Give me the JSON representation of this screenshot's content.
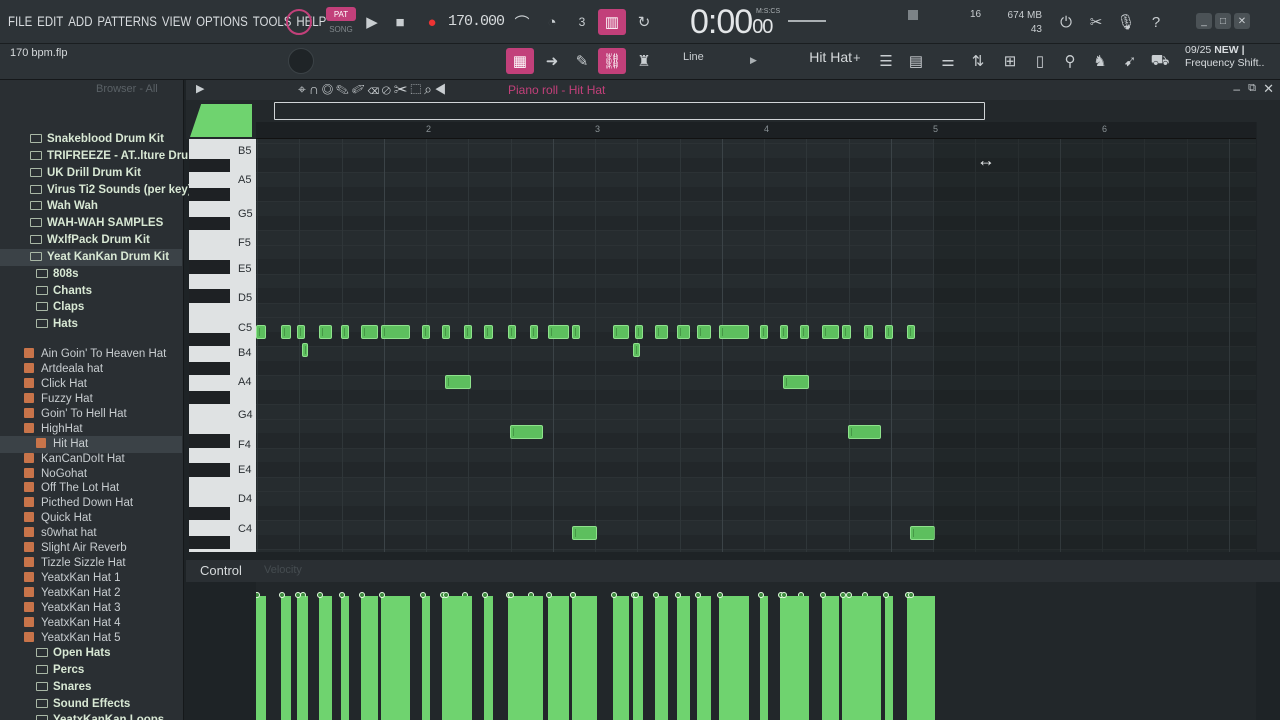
{
  "menu": [
    "FILE",
    "EDIT",
    "ADD",
    "PATTERNS",
    "VIEW",
    "OPTIONS",
    "TOOLS",
    "HELP"
  ],
  "transport": {
    "pat": "PAT",
    "song": "SONG",
    "tempo": "170.000",
    "time": "0:00",
    "time_small": "00",
    "time_label": "M:S:CS"
  },
  "status": {
    "mixer_value": "16",
    "memory": "674 MB",
    "cpu": "43"
  },
  "toolbar2": {
    "filename": "170 bpm.flp",
    "snap": "Line",
    "instrument": "Hit Hat",
    "hint_date": "09/25",
    "hint_new": "NEW |",
    "hint_text": "Frequency Shift.."
  },
  "browser": {
    "header": "Browser - All",
    "items": [
      {
        "label": "Snakeblood Drum Kit",
        "type": "folder",
        "indent": 0
      },
      {
        "label": "TRIFREEZE - AT..lture Drum Kit",
        "type": "folder",
        "indent": 0
      },
      {
        "label": "UK Drill Drum Kit",
        "type": "folder",
        "indent": 0
      },
      {
        "label": "Virus Ti2 Sounds (per key)",
        "type": "folder",
        "indent": 0
      },
      {
        "label": "Wah Wah",
        "type": "folder",
        "indent": 0
      },
      {
        "label": "WAH-WAH SAMPLES",
        "type": "folder",
        "indent": 0
      },
      {
        "label": "WxlfPack Drum Kit",
        "type": "folder",
        "indent": 0
      },
      {
        "label": "Yeat KanKan Drum Kit",
        "type": "folder",
        "indent": 0
      },
      {
        "label": "808s",
        "type": "folder",
        "indent": 1
      },
      {
        "label": "Chants",
        "type": "folder",
        "indent": 1
      },
      {
        "label": "Claps",
        "type": "folder",
        "indent": 1
      },
      {
        "label": "Hats",
        "type": "folder",
        "indent": 1
      },
      {
        "label": "",
        "type": "blank",
        "indent": 0
      },
      {
        "label": "Ain Goin' To Heaven Hat",
        "type": "file",
        "indent": 1
      },
      {
        "label": "Artdeala hat",
        "type": "file",
        "indent": 1
      },
      {
        "label": "Click Hat",
        "type": "file",
        "indent": 1
      },
      {
        "label": "Fuzzy Hat",
        "type": "file",
        "indent": 1
      },
      {
        "label": "Goin' To Hell Hat",
        "type": "file",
        "indent": 1
      },
      {
        "label": "HighHat",
        "type": "file",
        "indent": 1
      },
      {
        "label": "Hit Hat",
        "type": "file",
        "indent": 2
      },
      {
        "label": "KanCanDoIt Hat",
        "type": "file",
        "indent": 1
      },
      {
        "label": "NoGohat",
        "type": "file",
        "indent": 1
      },
      {
        "label": "Off The Lot Hat",
        "type": "file",
        "indent": 1
      },
      {
        "label": "Picthed Down Hat",
        "type": "file",
        "indent": 1
      },
      {
        "label": "Quick Hat",
        "type": "file",
        "indent": 1
      },
      {
        "label": "s0what hat",
        "type": "file",
        "indent": 1
      },
      {
        "label": "Slight Air Reverb",
        "type": "file",
        "indent": 1
      },
      {
        "label": "Tizzle Sizzle Hat",
        "type": "file",
        "indent": 1
      },
      {
        "label": "YeatxKan Hat 1",
        "type": "file",
        "indent": 1
      },
      {
        "label": "YeatxKan Hat 2",
        "type": "file",
        "indent": 1
      },
      {
        "label": "YeatxKan Hat 3",
        "type": "file",
        "indent": 1
      },
      {
        "label": "YeatxKan Hat 4",
        "type": "file",
        "indent": 1
      },
      {
        "label": "YeatxKan Hat 5",
        "type": "file",
        "indent": 1
      },
      {
        "label": "Open Hats",
        "type": "folder",
        "indent": 1
      },
      {
        "label": "Percs",
        "type": "folder",
        "indent": 1
      },
      {
        "label": "Snares",
        "type": "folder",
        "indent": 1
      },
      {
        "label": "Sound Effects",
        "type": "folder",
        "indent": 1
      },
      {
        "label": "YeatxKanKan Loops",
        "type": "folder",
        "indent": 1
      }
    ]
  },
  "piano_roll": {
    "title": "Piano roll - Hit Hat",
    "bar_numbers": [
      "2",
      "3",
      "4",
      "5",
      "6"
    ],
    "key_labels": [
      "B5",
      "A5",
      "G5",
      "F5",
      "E5",
      "D5",
      "C5",
      "B4",
      "A4",
      "G4",
      "F4",
      "E4",
      "D4",
      "C4"
    ],
    "control_label": "Control",
    "control_param": "Velocity"
  },
  "notes": [
    {
      "pitch": "C5",
      "start": 0,
      "len": 0.06
    },
    {
      "pitch": "C5",
      "start": 0.15,
      "len": 0.06
    },
    {
      "pitch": "B4",
      "start": 0.27,
      "len": 0.04
    },
    {
      "pitch": "C5",
      "start": 0.24,
      "len": 0.05
    },
    {
      "pitch": "C5",
      "start": 0.37,
      "len": 0.08
    },
    {
      "pitch": "C5",
      "start": 0.5,
      "len": 0.05
    },
    {
      "pitch": "C5",
      "start": 0.62,
      "len": 0.1
    },
    {
      "pitch": "C5",
      "start": 0.74,
      "len": 0.17
    },
    {
      "pitch": "C5",
      "start": 0.98,
      "len": 0.05
    },
    {
      "pitch": "C5",
      "start": 1.1,
      "len": 0.05
    },
    {
      "pitch": "C5",
      "start": 1.23,
      "len": 0.05
    },
    {
      "pitch": "C5",
      "start": 1.35,
      "len": 0.05
    },
    {
      "pitch": "C5",
      "start": 1.49,
      "len": 0.05
    },
    {
      "pitch": "C5",
      "start": 1.62,
      "len": 0.05
    },
    {
      "pitch": "C5",
      "start": 1.73,
      "len": 0.12
    },
    {
      "pitch": "C5",
      "start": 1.87,
      "len": 0.05
    },
    {
      "pitch": "C5",
      "start": 2.11,
      "len": 0.1
    },
    {
      "pitch": "B4",
      "start": 2.23,
      "len": 0.04
    },
    {
      "pitch": "C5",
      "start": 2.24,
      "len": 0.05
    },
    {
      "pitch": "C5",
      "start": 2.36,
      "len": 0.08
    },
    {
      "pitch": "C5",
      "start": 2.49,
      "len": 0.08
    },
    {
      "pitch": "C5",
      "start": 2.61,
      "len": 0.08
    },
    {
      "pitch": "C5",
      "start": 2.74,
      "len": 0.18
    },
    {
      "pitch": "C5",
      "start": 2.98,
      "len": 0.05
    },
    {
      "pitch": "C5",
      "start": 3.1,
      "len": 0.05
    },
    {
      "pitch": "C5",
      "start": 3.22,
      "len": 0.05
    },
    {
      "pitch": "C5",
      "start": 3.35,
      "len": 0.1
    },
    {
      "pitch": "C5",
      "start": 3.47,
      "len": 0.05
    },
    {
      "pitch": "C5",
      "start": 3.6,
      "len": 0.05
    },
    {
      "pitch": "C5",
      "start": 3.72,
      "len": 0.05
    },
    {
      "pitch": "C5",
      "start": 3.85,
      "len": 0.05
    },
    {
      "pitch": "A4",
      "start": 1.12,
      "len": 0.15
    },
    {
      "pitch": "A4",
      "start": 3.12,
      "len": 0.15
    },
    {
      "pitch": "F4",
      "start": 1.5,
      "len": 0.2
    },
    {
      "pitch": "F4",
      "start": 3.5,
      "len": 0.2
    },
    {
      "pitch": "C4",
      "start": 1.87,
      "len": 0.15
    },
    {
      "pitch": "C4",
      "start": 3.87,
      "len": 0.15
    }
  ],
  "colors": {
    "accent": "#c2407a",
    "note": "#5dbf5e",
    "panel": "#2a2f33"
  }
}
